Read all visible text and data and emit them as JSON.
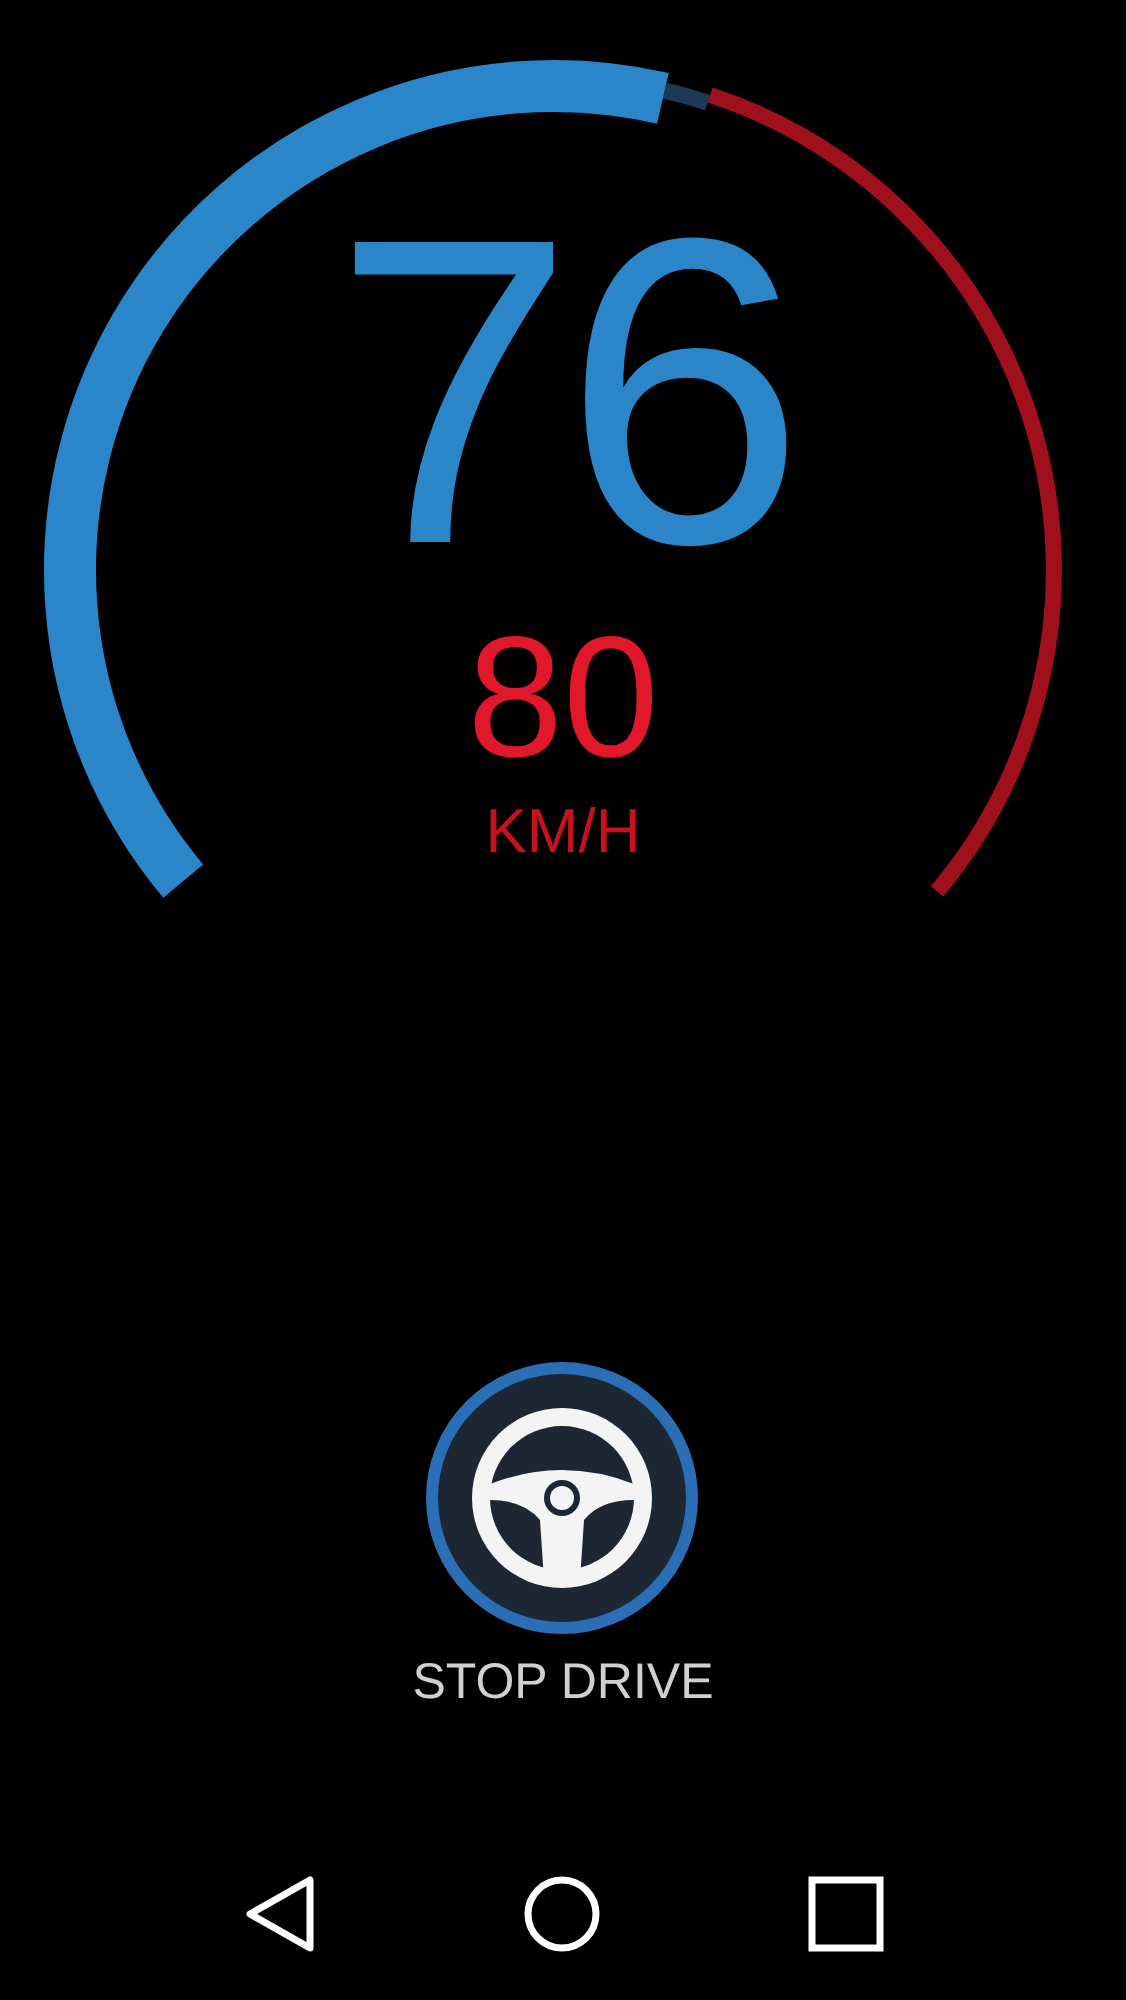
{
  "gauge": {
    "speed": "76",
    "limit": "80",
    "unit": "KM/H"
  },
  "drive_button": {
    "label": "STOP DRIVE"
  },
  "nav_bar": {
    "buttons": [
      {
        "kind": "back"
      },
      {
        "kind": "home"
      },
      {
        "kind": "recents"
      }
    ]
  }
}
